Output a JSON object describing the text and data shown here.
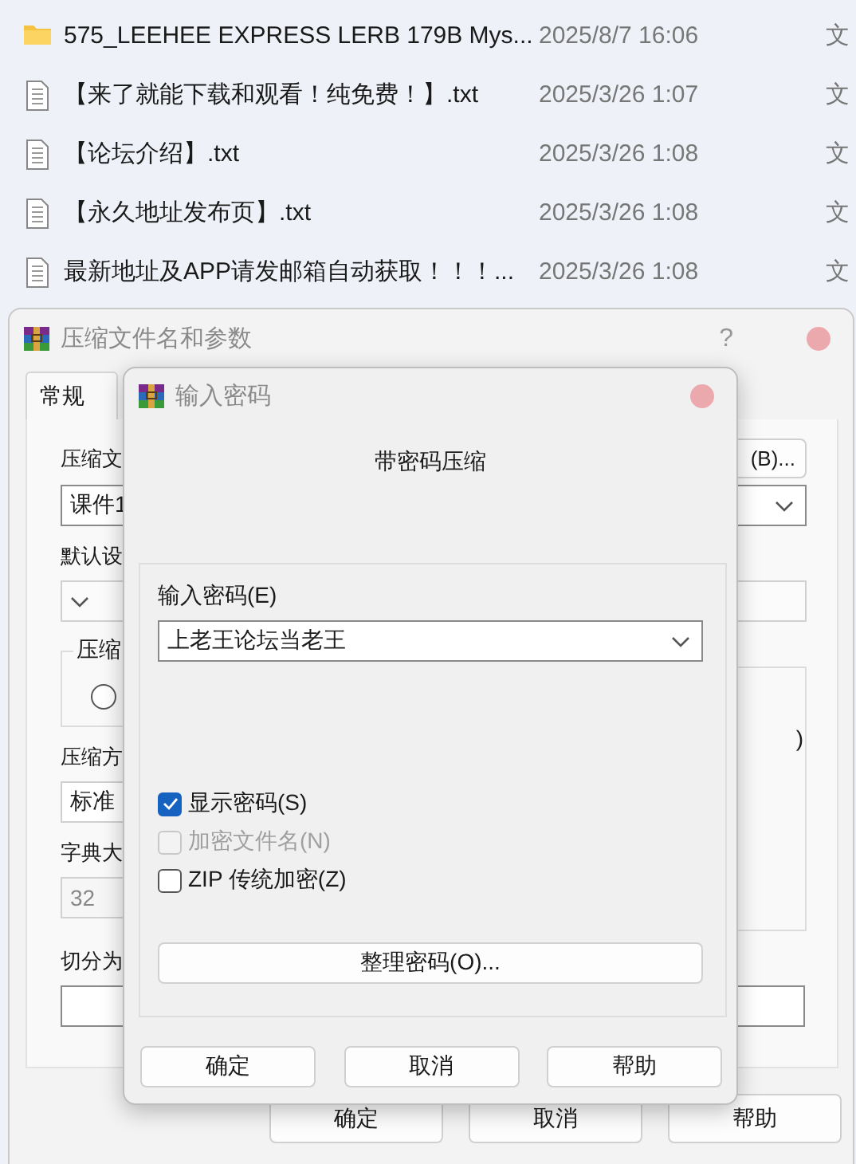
{
  "file_list": {
    "rows": [
      {
        "kind": "folder",
        "name": "575_LEEHEE EXPRESS LERB 179B Mys...",
        "modified": "2025/8/7 16:06",
        "type": "文"
      },
      {
        "kind": "text",
        "name": "【来了就能下载和观看！纯免费！】.txt",
        "modified": "2025/3/26 1:07",
        "type": "文"
      },
      {
        "kind": "text",
        "name": "【论坛介绍】.txt",
        "modified": "2025/3/26 1:08",
        "type": "文"
      },
      {
        "kind": "text",
        "name": "【永久地址发布页】.txt",
        "modified": "2025/3/26 1:08",
        "type": "文"
      },
      {
        "kind": "text",
        "name": "最新地址及APP请发邮箱自动获取！！！...",
        "modified": "2025/3/26 1:08",
        "type": "文"
      }
    ]
  },
  "archive_dialog": {
    "title": "压缩文件名和参数",
    "help": "?",
    "tabs": [
      {
        "label": "常规",
        "selected": true
      }
    ],
    "archive_name_label": "压缩文",
    "browse_button": "(B)...",
    "archive_name": "课件1",
    "profile_label": "默认设",
    "group_label": "压缩",
    "radio": {
      "selected": false
    },
    "group_text": ")",
    "method_label": "压缩方",
    "method": "标准",
    "dictionary_label": "字典大",
    "dictionary": "32",
    "split_label": "切分为",
    "buttons": [
      "确定",
      "取消",
      "帮助"
    ]
  },
  "password_dialog": {
    "title": "输入密码",
    "heading": "带密码压缩",
    "password_label": "输入密码(E)",
    "password": "上老王论坛当老王",
    "checkboxes": [
      {
        "label": "显示密码(S)",
        "checked": true,
        "disabled": false
      },
      {
        "label": "加密文件名(N)",
        "checked": false,
        "disabled": true
      },
      {
        "label": "ZIP 传统加密(Z)",
        "checked": false,
        "disabled": false
      }
    ],
    "organize_button": "整理密码(O)...",
    "buttons": [
      "确定",
      "取消",
      "帮助"
    ]
  }
}
